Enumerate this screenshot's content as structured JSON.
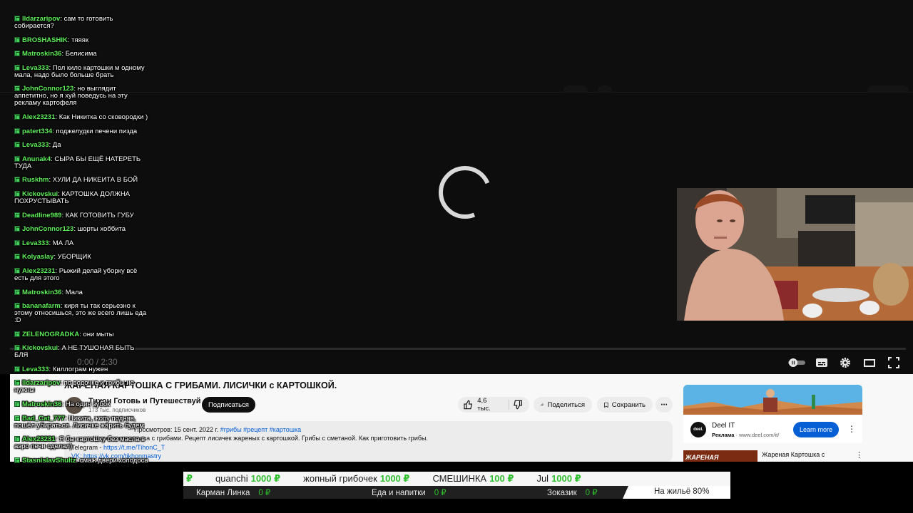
{
  "player": {
    "time": "0:00 / 2:30",
    "controls": [
      "autoplay-toggle",
      "subtitles",
      "settings",
      "theater-mode",
      "fullscreen"
    ]
  },
  "video": {
    "title": "ЖАРЕНАЯ КАРТОШКА С ГРИБАМИ. ЛИСИЧКИ с КАРТОШКОЙ.",
    "channel": "Тихон Готовь и Путешествуй",
    "subscribers": "173 тыс. подписчиков",
    "subscribe_label": "Подписаться",
    "likes": "4,6 тыс.",
    "share_label": "Поделиться",
    "save_label": "Сохранить",
    "meta": "Просмотров: 15 сент. 2022 г.",
    "hashtags": "#грибы #рецепт #картошка",
    "description": "Жареная картошка с грибами. Рецепт лисичек жареных с картошкой. Грибы с сметаной. Как приготовить грибы.",
    "telegram_label": "Telegram",
    "telegram_link": "https://t.me/TihonC_T",
    "vk_link": "VK: https://vk.com/tikhonmastry"
  },
  "ad": {
    "advertiser": "Deel IT",
    "label": "Реклама",
    "domain": "www.deel.com/it/",
    "logo_text": "deel.",
    "cta": "Learn more"
  },
  "related": {
    "thumb_text": "ЖАРЕНАЯ",
    "title": "Жареная Картошка с"
  },
  "chat": [
    {
      "user": "Ildarzaripov",
      "text": "сам  то готовить собирается?"
    },
    {
      "user": "BROSHASHIK",
      "text": "тяяяк"
    },
    {
      "user": "Matroskin36",
      "text": "Белисима"
    },
    {
      "user": "Leva333",
      "text": "Пол кило картошки м одному мала, надо было больше брать"
    },
    {
      "user": "JohnConnor123",
      "text": "но выглядит аппетитно, но я хуй поведусь на эту рекламу картофеля"
    },
    {
      "user": "Alex23231",
      "text": "Как Никитка со сковородки )"
    },
    {
      "user": "patert334",
      "text": "поджелудки печени пизда"
    },
    {
      "user": "Leva333",
      "text": "Да"
    },
    {
      "user": "Anunak4",
      "text": "СЫРА БЫ ЕЩЁ НАТЕРЕТЬ ТУДА"
    },
    {
      "user": "Ruskhm",
      "text": "ХУЛИ ДА НИКЕИТА В БОЙ"
    },
    {
      "user": "Kickovskui",
      "text": "КАРТОШКА ДОЛЖНА ПОХРУСТЫВАТЬ"
    },
    {
      "user": "Deadline989",
      "text": "КАК ГОТОВИТЬ ГУБУ"
    },
    {
      "user": "JohnConnor123",
      "text": "шорты хоббита"
    },
    {
      "user": "Leva333",
      "text": "МА ЛА"
    },
    {
      "user": "Kolyaslay",
      "text": "УБОРЩИК"
    },
    {
      "user": "Alex23231",
      "text": "Рыжий делай уборку всё есть для этого"
    },
    {
      "user": "Matroskin36",
      "text": "Мала"
    },
    {
      "user": "bananafarm",
      "text": "киря ты так серьезно к этому относишься, это же всего лишь  еда :D"
    },
    {
      "user": "ZELENOGRADKA",
      "text": "они мыты"
    },
    {
      "user": "Kickovskui",
      "text": "А НЕ ТУШОНАЯ БЫТЬ БЛЯ"
    },
    {
      "user": "Leva333",
      "text": "Киллограм нужен"
    },
    {
      "user": "Ildarzaripov",
      "text": "по водочке и грибы не нужны"
    },
    {
      "user": "Matroskin36",
      "text": "На один зубок"
    },
    {
      "user": "Bad_Cat_777",
      "text": "Никита, жопу подняв, пошёл убираться. Лисичке жарить будем"
    },
    {
      "user": "Alex23231",
      "text": "Я бы картошку без масла в аэро  печи сделал)"
    },
    {
      "user": "StasnislavShultz",
      "text": "смаж двери холодоса"
    }
  ],
  "ticker": {
    "donations": [
      {
        "name": "",
        "amount": "₽"
      },
      {
        "name": "quanchi",
        "amount": "1000 ₽"
      },
      {
        "name": "жопный грибочек",
        "amount": "1000 ₽"
      },
      {
        "name": "СМЕШИНКА",
        "amount": "100 ₽"
      },
      {
        "name": "Jul",
        "amount": "1000 ₽"
      }
    ],
    "goals": [
      {
        "name": "Карман Линка",
        "amount": "0 ₽"
      },
      {
        "name": "Еда и напитки",
        "amount": "0 ₽"
      },
      {
        "name": "Зоказик",
        "amount": "0 ₽"
      }
    ],
    "progress_goal": "На жильё 80%",
    "progress_fraction": 0.8
  }
}
